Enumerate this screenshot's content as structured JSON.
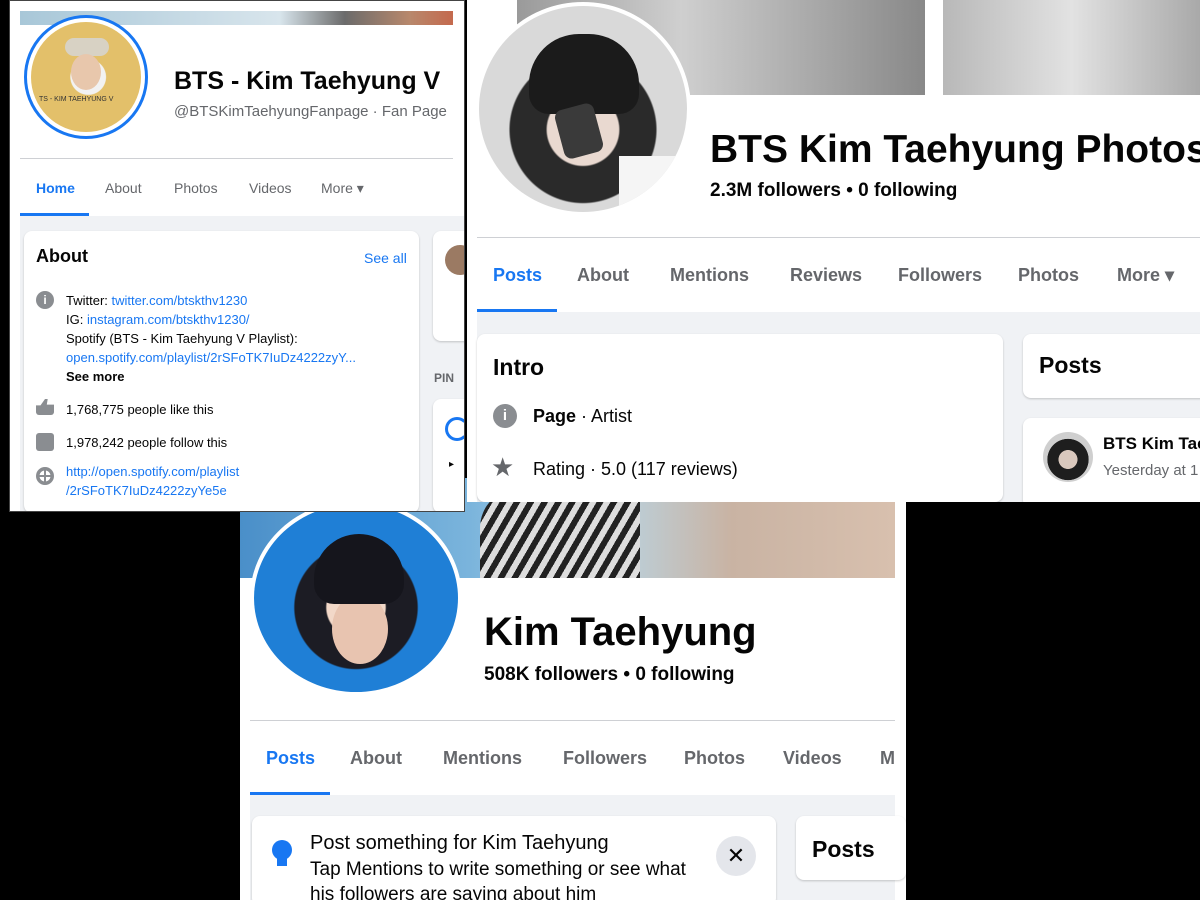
{
  "panel_a": {
    "page_name": "BTS - Kim Taehyung V",
    "handle": "@BTSKimTaehyungFanpage · Fan Page",
    "tabs": [
      "Home",
      "About",
      "Photos",
      "Videos",
      "More ▾"
    ],
    "about": {
      "title": "About",
      "see_all": "See all",
      "twitter_label": "Twitter:",
      "twitter_link": "twitter.com/btskthv1230",
      "ig_label": "IG:",
      "ig_link": "instagram.com/btskthv1230/",
      "spotify_label": "Spotify (BTS - Kim Taehyung V Playlist):",
      "spotify_link": "open.spotify.com/playlist/2rSFoTK7IuDz4222zyY...",
      "see_more": "See more",
      "likes": "1,768,775 people like this",
      "follows": "1,978,242 people follow this",
      "website_line1": "http://open.spotify.com/playlist",
      "website_line2": "/2rSFoTK7IuDz4222zyYe5e"
    },
    "pinned_label": "PIN",
    "avatar_caption": "TS - KIM TAEHYUNG V"
  },
  "panel_b": {
    "page_name": "BTS Kim Taehyung Photos",
    "stats": "2.3M followers • 0 following",
    "tabs": [
      "Posts",
      "About",
      "Mentions",
      "Reviews",
      "Followers",
      "Photos",
      "More ▾"
    ],
    "intro": {
      "title": "Intro",
      "page_label": "Page",
      "page_type": " · Artist",
      "rating": "Rating · 5.0 (117 reviews)"
    },
    "posts_title": "Posts",
    "post_author": "BTS Kim Tae",
    "post_time": "Yesterday at 1"
  },
  "panel_c": {
    "page_name": "Kim Taehyung",
    "stats": "508K followers • 0 following",
    "tabs": [
      "Posts",
      "About",
      "Mentions",
      "Followers",
      "Photos",
      "Videos",
      "M"
    ],
    "prompt_title": "Post something for Kim Taehyung",
    "prompt_body_1": "Tap Mentions to write something or see what",
    "prompt_body_2": "his followers are saying about him",
    "posts_title": "Posts"
  },
  "colors": {
    "accent": "#1877f2",
    "secondary_text": "#65676b",
    "background": "#f0f2f5"
  }
}
